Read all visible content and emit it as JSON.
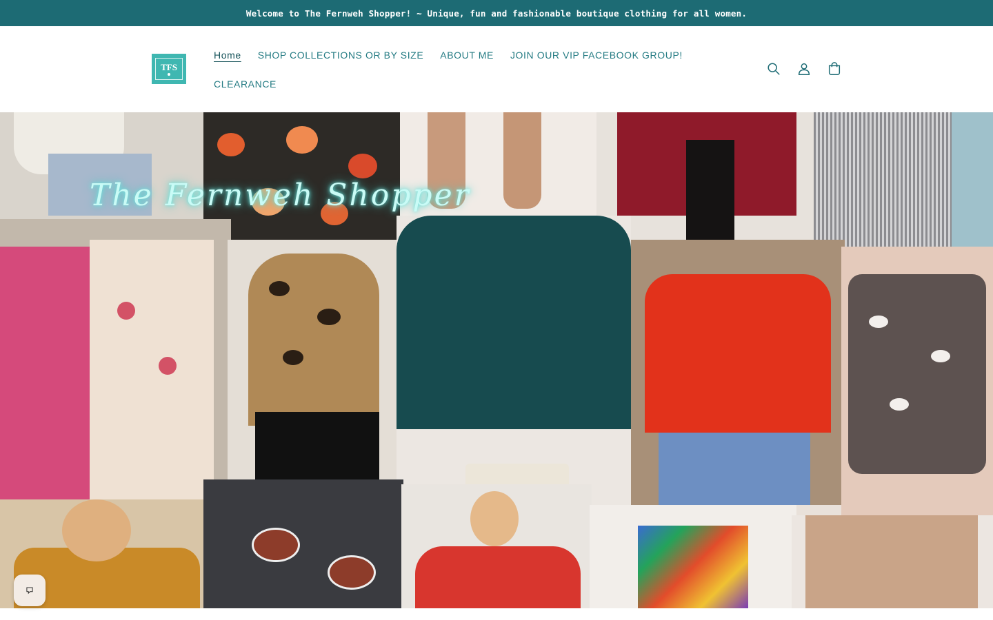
{
  "announcement": {
    "text": "Welcome to The Fernweh Shopper! ~ Unique, fun and fashionable boutique clothing for all women."
  },
  "header": {
    "logo_text": "TFS",
    "nav": [
      {
        "label": "Home",
        "active": true
      },
      {
        "label": "SHOP COLLECTIONS OR BY SIZE"
      },
      {
        "label": "ABOUT ME"
      },
      {
        "label": "JOIN OUR VIP FACEBOOK GROUP!"
      },
      {
        "label": "CLEARANCE"
      }
    ],
    "icons": [
      "search-icon",
      "account-icon",
      "cart-icon"
    ]
  },
  "hero": {
    "title": "The Fernweh Shopper"
  },
  "chat": {
    "icon": "chat-icon"
  },
  "colors": {
    "brand_teal": "#1d6b74",
    "logo_teal": "#3fb7b1"
  }
}
